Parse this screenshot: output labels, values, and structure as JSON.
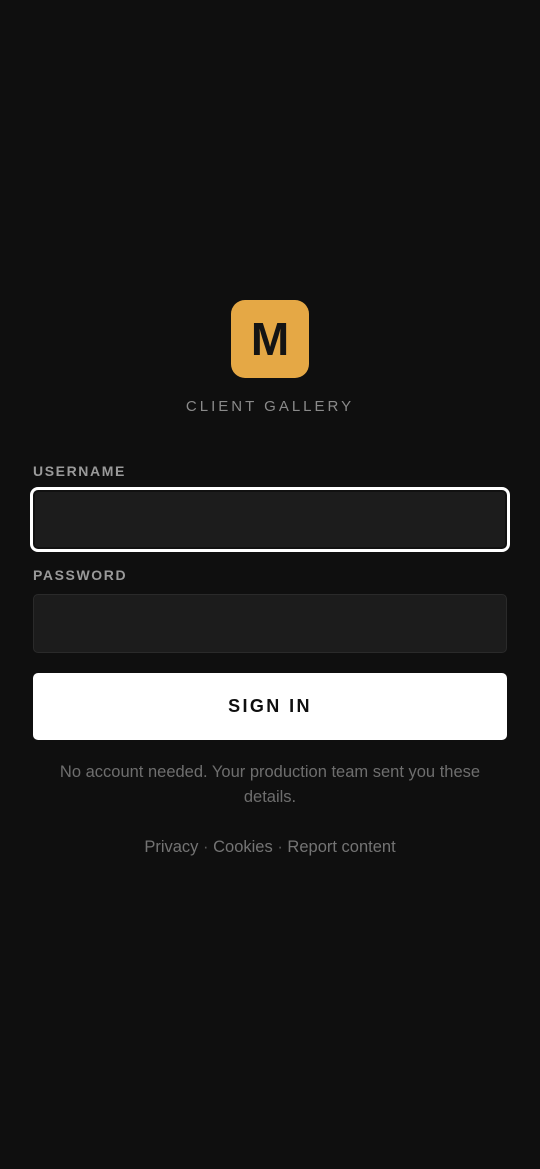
{
  "brand": {
    "logo_letter": "M",
    "name": "CLIENT GALLERY",
    "accent_color": "#e5a845"
  },
  "form": {
    "username_label": "USERNAME",
    "username_value": "",
    "password_label": "PASSWORD",
    "password_value": "",
    "signin_label": "SIGN IN"
  },
  "note": "No account needed. Your production team sent you these details.",
  "footer": {
    "links": [
      "Privacy",
      "Cookies",
      "Report content"
    ],
    "separator": "·"
  }
}
